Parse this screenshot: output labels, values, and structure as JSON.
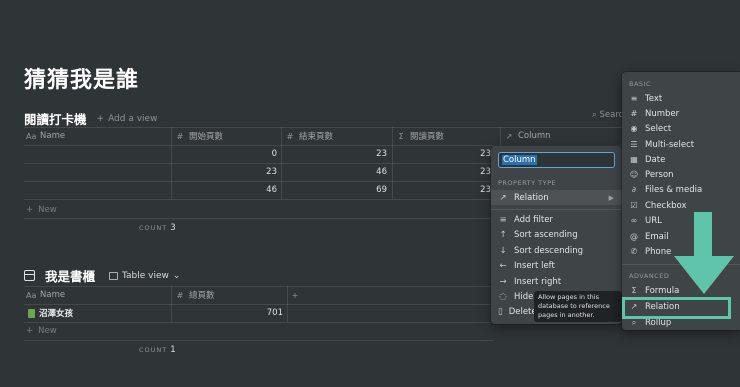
{
  "page": {
    "title": "猜猜我是誰"
  },
  "db1": {
    "title": "閱讀打卡機",
    "add_view": "Add a view",
    "search": "Searc",
    "columns": [
      "Name",
      "開始頁數",
      "結束頁數",
      "閱讀頁數",
      "Column"
    ],
    "column_icons": [
      "name-icon",
      "hash-icon",
      "hash-icon",
      "sigma-icon",
      "arrow-icon"
    ],
    "rows": [
      {
        "start": "0",
        "end": "23",
        "read": "23"
      },
      {
        "start": "23",
        "end": "46",
        "read": "23"
      },
      {
        "start": "46",
        "end": "69",
        "read": "23"
      }
    ],
    "new_label": "New",
    "count_label": "COUNT",
    "count_value": "3"
  },
  "db2": {
    "title": "我是書櫃",
    "view_label": "Table view",
    "columns": [
      "Name",
      "總頁數"
    ],
    "rows": [
      {
        "name": "沼澤女孩",
        "total": "701"
      }
    ],
    "new_label": "New",
    "count_label": "COUNT",
    "count_value": "1"
  },
  "column_menu": {
    "input_value": "Column",
    "property_type_label": "PROPERTY TYPE",
    "property_type_value": "Relation",
    "items": [
      "Add filter",
      "Sort ascending",
      "Sort descending",
      "Insert left",
      "Insert right",
      "Hide",
      "Delete"
    ],
    "tooltip": "Allow pages in this database to reference pages in another."
  },
  "type_menu": {
    "basic_label": "BASIC",
    "basic_items": [
      "Text",
      "Number",
      "Select",
      "Multi-select",
      "Date",
      "Person",
      "Files & media",
      "Checkbox",
      "URL",
      "Email",
      "Phone"
    ],
    "advanced_label": "ADVANCED",
    "advanced_items": [
      "Formula",
      "Relation",
      "Rollup"
    ]
  },
  "colors": {
    "background": "#2f3437",
    "menu": "#3f4447",
    "accent_input": "#5fa7d9",
    "annotation": "#5ec4aa"
  }
}
